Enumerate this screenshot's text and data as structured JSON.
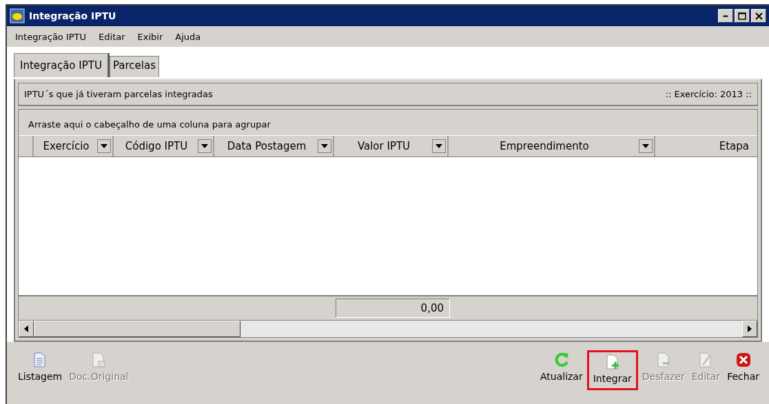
{
  "window": {
    "title": "Integração IPTU"
  },
  "menu": [
    "Integração IPTU",
    "Editar",
    "Exibir",
    "Ajuda"
  ],
  "tabs": [
    {
      "label": "Integração IPTU",
      "selected": true
    },
    {
      "label": "Parcelas",
      "selected": false
    }
  ],
  "panel": {
    "title": "IPTU´s que já tiveram parcelas integradas",
    "info": ":: Exercício: 2013 ::"
  },
  "grid": {
    "group_hint": "Arraste aqui o cabeçalho de uma coluna para agrupar",
    "columns": [
      {
        "label": "Exercício",
        "kind": "dropdown"
      },
      {
        "label": "Código IPTU",
        "kind": "dropdown"
      },
      {
        "label": "Data Postagem",
        "kind": "dropdown"
      },
      {
        "label": "Valor IPTU",
        "kind": "dropdown"
      },
      {
        "label": "Empreendimento",
        "kind": "dropdown"
      },
      {
        "label": "Etapa",
        "kind": "plain"
      }
    ],
    "total": "0,00"
  },
  "toolbar": [
    {
      "kind": "list",
      "label": "Listagem",
      "disabled": false,
      "highlighted": false
    },
    {
      "kind": "original",
      "label": "Doc.Original",
      "disabled": true,
      "highlighted": false
    },
    {
      "kind": "spacer"
    },
    {
      "kind": "refresh",
      "label": "Atualizar",
      "disabled": false,
      "highlighted": false
    },
    {
      "kind": "add",
      "label": "Integrar",
      "disabled": false,
      "highlighted": true
    },
    {
      "kind": "undo",
      "label": "Desfazer",
      "disabled": true,
      "highlighted": false
    },
    {
      "kind": "edit",
      "label": "Editar",
      "disabled": true,
      "highlighted": false
    },
    {
      "kind": "close",
      "label": "Fechar",
      "disabled": false,
      "highlighted": false
    }
  ]
}
